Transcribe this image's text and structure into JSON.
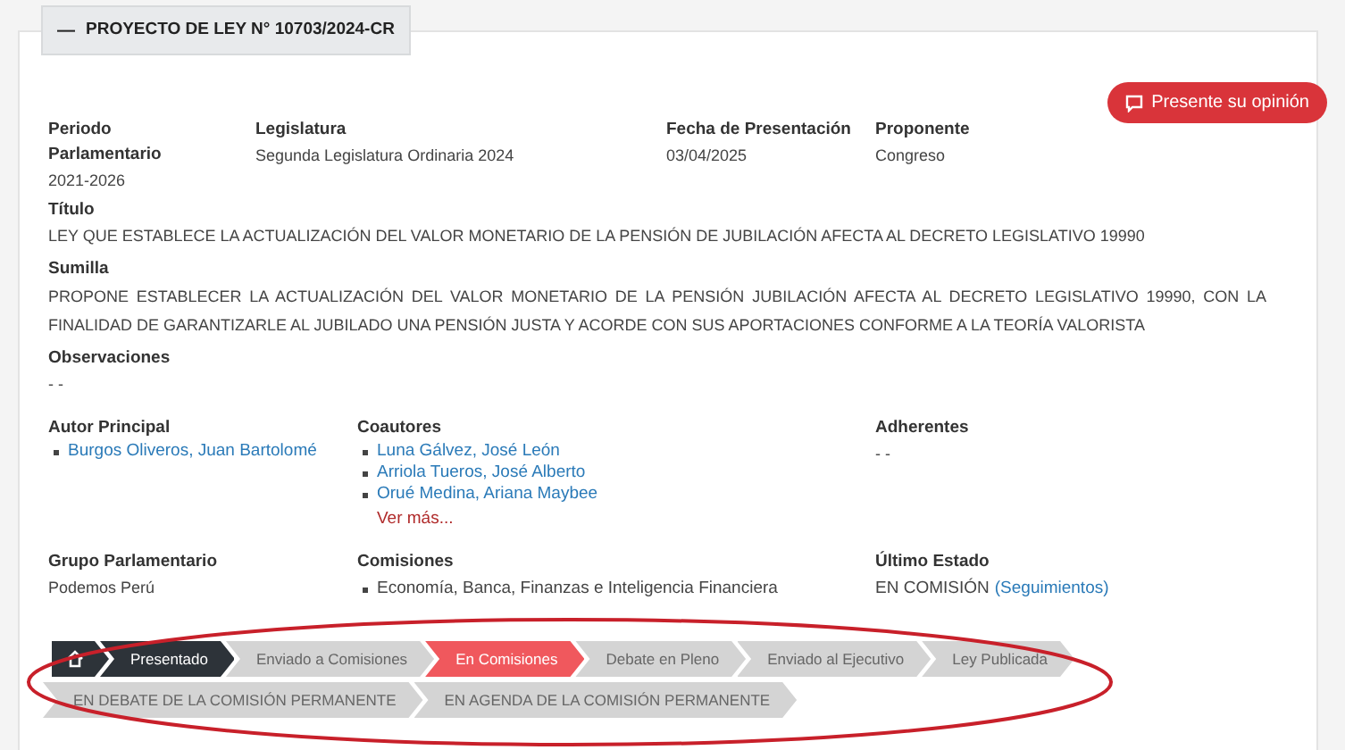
{
  "header": {
    "toggle": "—",
    "title": "PROYECTO DE LEY N° 10703/2024-CR"
  },
  "opinion_button": {
    "label": "Presente su opinión"
  },
  "info_row": [
    {
      "label": "Periodo Parlamentario",
      "value": "2021-2026"
    },
    {
      "label": "Legislatura",
      "value": "Segunda Legislatura Ordinaria 2024"
    },
    {
      "label": "Fecha de Presentación",
      "value": "03/04/2025"
    },
    {
      "label": "Proponente",
      "value": "Congreso"
    }
  ],
  "titulo": {
    "label": "Título",
    "value": "LEY QUE ESTABLECE LA ACTUALIZACIÓN DEL VALOR MONETARIO DE LA PENSIÓN DE JUBILACIÓN AFECTA AL DECRETO LEGISLATIVO 19990"
  },
  "sumilla": {
    "label": "Sumilla",
    "value": "PROPONE ESTABLECER LA ACTUALIZACIÓN DEL VALOR MONETARIO DE LA PENSIÓN JUBILACIÓN AFECTA AL DECRETO LEGISLATIVO 19990, CON LA FINALIDAD DE GARANTIZARLE AL JUBILADO UNA PENSIÓN JUSTA Y ACORDE CON SUS APORTACIONES CONFORME A LA TEORÍA VALORISTA"
  },
  "observaciones": {
    "label": "Observaciones",
    "value": "- -"
  },
  "autor_principal": {
    "label": "Autor Principal",
    "items": [
      "Burgos Oliveros, Juan Bartolomé"
    ]
  },
  "coautores": {
    "label": "Coautores",
    "items": [
      "Luna Gálvez, José León",
      "Arriola Tueros, José Alberto",
      "Orué Medina, Ariana Maybee"
    ],
    "more": "Ver más..."
  },
  "adherentes": {
    "label": "Adherentes",
    "value": "- -"
  },
  "grupo": {
    "label": "Grupo Parlamentario",
    "value": "Podemos Perú"
  },
  "comisiones": {
    "label": "Comisiones",
    "items": [
      "Economía, Banca, Finanzas e Inteligencia Financiera"
    ]
  },
  "ultimo_estado": {
    "label": "Último Estado",
    "value": "EN COMISIÓN",
    "link": "(Seguimientos)"
  },
  "steps": [
    {
      "kind": "home",
      "done": true,
      "selected": false
    },
    {
      "kind": "step",
      "label": "Presentado",
      "done": true,
      "selected": false
    },
    {
      "kind": "step",
      "label": "Enviado a Comisiones",
      "done": false,
      "selected": false
    },
    {
      "kind": "step",
      "label": "En Comisiones",
      "done": false,
      "selected": true
    },
    {
      "kind": "step",
      "label": "Debate en Pleno",
      "done": false,
      "selected": false
    },
    {
      "kind": "step",
      "label": "Enviado al Ejecutivo",
      "done": false,
      "selected": false
    },
    {
      "kind": "step",
      "label": "Ley Publicada",
      "done": false,
      "selected": false
    },
    {
      "kind": "step",
      "label": "EN DEBATE DE LA COMISIÓN PERMANENTE",
      "done": false,
      "selected": false
    },
    {
      "kind": "step",
      "label": "EN AGENDA DE LA COMISIÓN PERMANENTE",
      "done": false,
      "selected": false
    }
  ]
}
